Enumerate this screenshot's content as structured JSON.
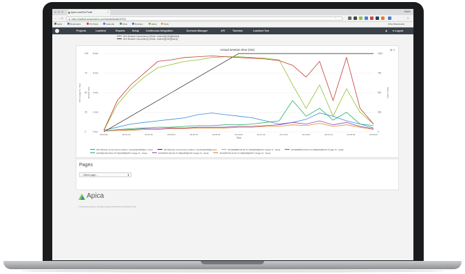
{
  "browser": {
    "tab_title": "Apica LoadTest Portal",
    "profile_name": "Martin",
    "url_host": "https://loadtest.apicasystem.com",
    "url_path": "/results/details/37913",
    "bookmarks": [
      {
        "label": "Apps",
        "color": "#6b6b6b"
      },
      {
        "label": "Bookmarks",
        "color": "#4a7ed6"
      },
      {
        "label": "P4 Portal",
        "color": "#d04a3c"
      },
      {
        "label": "Calendar",
        "color": "#4a7ed6"
      },
      {
        "label": "Drive",
        "color": "#3aa65a"
      },
      {
        "label": "Dropbox",
        "color": "#3b82d6"
      },
      {
        "label": "Apica",
        "color": "#8cc63f"
      },
      {
        "label": "Tools",
        "color": "#e0b13a"
      }
    ],
    "other_bookmarks": "Other Bookmarks"
  },
  "nav": {
    "items": [
      "Projects",
      "Loadtest",
      "Reports",
      "Setup",
      "Continuous Integration",
      "Scenario Manager",
      "API",
      "Tutorials",
      "Loadtest Tool"
    ],
    "logout": "Logout"
  },
  "top_legend": [
    {
      "label": "AHJ Browse Concurrency (20min, Cached)[1000][started]",
      "color": "#777777"
    },
    {
      "label": "AHJ Browse Concurrency (20min, Cached)[1000][users]",
      "color": "#333333"
    }
  ],
  "chart_data": {
    "type": "line",
    "title": "Actual session time (ms)",
    "x": [
      "00:00:00",
      "00:01:00",
      "00:02:00",
      "00:03:00",
      "00:04:00",
      "00:05:00",
      "00:06:00",
      "00:07:00",
      "00:08:00",
      "00:09:00",
      "00:10:00",
      "00:11:00",
      "00:12:00",
      "00:13:00",
      "00:14:00",
      "00:15:00",
      "00:16:00",
      "00:17:00",
      "00:18:00",
      "00:19:00",
      "00:20:00"
    ],
    "x_tick_labels": [
      "00:00:00",
      "00:01:40",
      "00:03:20",
      "00:05:00",
      "00:06:40",
      "00:08:20",
      "00:10:00",
      "00:11:40",
      "00:13:20",
      "00:15:00",
      "00:16:40",
      "00:18:20",
      "00:20:00"
    ],
    "xlabel": "Time",
    "y_left_cpu_label": "CPU usage % - Now",
    "y_left_cpu_ticks": [
      0,
      25,
      50,
      75,
      100
    ],
    "y_left_session_label": "Session time",
    "y_left_session_ticks": [
      "0 ms",
      "2 min",
      "4 min",
      "6 min",
      "8 min"
    ],
    "y_right_label": "Active users",
    "y_right_ticks": [
      0,
      250,
      500,
      750,
      1000
    ],
    "ylim": [
      0,
      100
    ],
    "series": [
      {
        "name": "AHJ Browse Concurrency (20min, Cached)[1000][sec. time]",
        "color": "#2f8bd6",
        "axis": "cpu",
        "values": [
          2,
          6,
          10,
          12,
          14,
          16,
          18,
          22,
          24,
          22,
          20,
          18,
          14,
          10,
          12,
          16,
          24,
          20,
          14,
          10,
          8
        ]
      },
      {
        "name": "AHJ Browse Concurrency (20min, Cached)[1000][users]",
        "color": "#222222",
        "axis": "cpu",
        "values": [
          0,
          10,
          20,
          30,
          40,
          50,
          60,
          70,
          80,
          90,
          100,
          100,
          100,
          100,
          100,
          100,
          100,
          100,
          100,
          100,
          100
        ]
      },
      {
        "name": "AHJWEB08 [10.91.31.232][1000][CPU Usage % - Now]",
        "color": "#8bbf2a",
        "axis": "cpu",
        "values": [
          2,
          35,
          55,
          70,
          82,
          86,
          90,
          92,
          95,
          96,
          96,
          95,
          94,
          92,
          60,
          30,
          60,
          20,
          55,
          25,
          10
        ]
      },
      {
        "name": "AHJWEB09 [10.91.31.233][1000][CPU Usage % - Now]",
        "color": "#c0392b",
        "axis": "cpu",
        "values": [
          2,
          40,
          60,
          75,
          90,
          92,
          95,
          96,
          97,
          96,
          95,
          94,
          93,
          91,
          85,
          70,
          90,
          40,
          95,
          30,
          10
        ]
      },
      {
        "name": "AHJSQL09 [10.91.27.91][1000][CPU Usage % - Now]",
        "color": "#27ae60",
        "axis": "cpu",
        "values": [
          1,
          3,
          4,
          5,
          6,
          6,
          7,
          8,
          8,
          9,
          9,
          10,
          12,
          14,
          40,
          20,
          30,
          15,
          25,
          10,
          5
        ]
      },
      {
        "name": "AHJAPP12 [10.91.27.29][1000][CPU Usage % - Now]",
        "color": "#8e44ad",
        "axis": "cpu",
        "values": [
          1,
          2,
          3,
          4,
          4,
          5,
          5,
          6,
          6,
          6,
          7,
          7,
          8,
          9,
          12,
          10,
          14,
          9,
          12,
          7,
          4
        ]
      },
      {
        "name": "AHJAPP15 [10.91.27.30][1000][CPU Usage % - Now]",
        "color": "#e67e22",
        "axis": "cpu",
        "values": [
          1,
          2,
          2,
          3,
          3,
          4,
          4,
          5,
          5,
          5,
          6,
          6,
          7,
          7,
          9,
          8,
          11,
          7,
          9,
          6,
          3
        ]
      }
    ]
  },
  "pages": {
    "title": "Pages",
    "select_value": "-- Select page --"
  },
  "footer": {
    "brand": "Apica",
    "copyright": "© 2016 Apica Systems. All rights reserved. Build 2016. (Dev Build: 3.5.8)"
  }
}
